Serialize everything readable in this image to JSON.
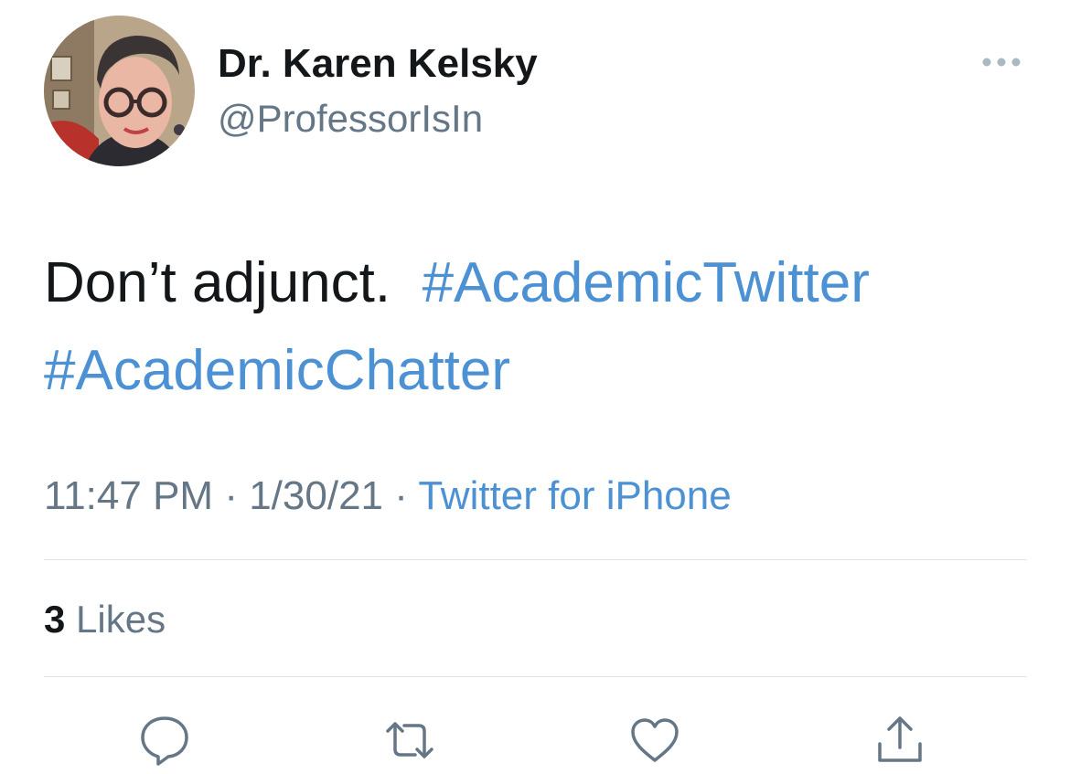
{
  "tweet": {
    "author": {
      "display_name": "Dr. Karen Kelsky",
      "handle": "@ProfessorIsIn",
      "avatar": "profile-photo"
    },
    "text": "Don’t adjunct.",
    "hashtags": [
      "#AcademicTwitter",
      "#AcademicChatter"
    ],
    "time": "11:47 PM",
    "date": "1/30/21",
    "separator": "·",
    "source": "Twitter for iPhone",
    "likes": {
      "count": "3",
      "label": "Likes"
    }
  },
  "actions": [
    {
      "name": "reply",
      "icon": "speech-bubble-icon"
    },
    {
      "name": "retweet",
      "icon": "retweet-icon"
    },
    {
      "name": "like",
      "icon": "heart-icon"
    },
    {
      "name": "share",
      "icon": "share-icon"
    }
  ],
  "more_icon": "ellipsis-icon",
  "colors": {
    "text": "#14171a",
    "secondary": "#657786",
    "link": "#4b91d3",
    "divider": "#dde2e6"
  }
}
